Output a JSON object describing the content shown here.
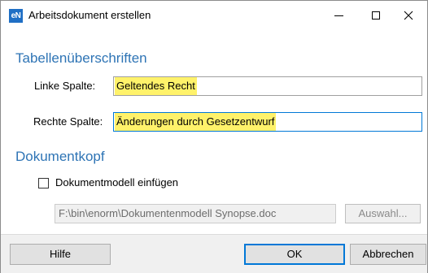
{
  "window": {
    "title": "Arbeitsdokument erstellen",
    "app_icon_text": "eN",
    "accent_color": "#2e74b5",
    "focus_color": "#0078d7",
    "highlight_color": "#fff26a"
  },
  "table_headers": {
    "heading": "Tabellenüberschriften",
    "left_label": "Linke Spalte:",
    "left_value": "Geltendes Recht",
    "right_label": "Rechte Spalte:",
    "right_value": "Änderungen durch Gesetzentwurf"
  },
  "document_header": {
    "heading": "Dokumentkopf",
    "checkbox_label": "Dokumentmodell einfügen",
    "checkbox_checked": false,
    "path": "F:\\bin\\enorm\\Dokumentenmodell Synopse.doc",
    "browse_label": "Auswahl..."
  },
  "footer": {
    "help_label": "Hilfe",
    "ok_label": "OK",
    "cancel_label": "Abbrechen"
  }
}
